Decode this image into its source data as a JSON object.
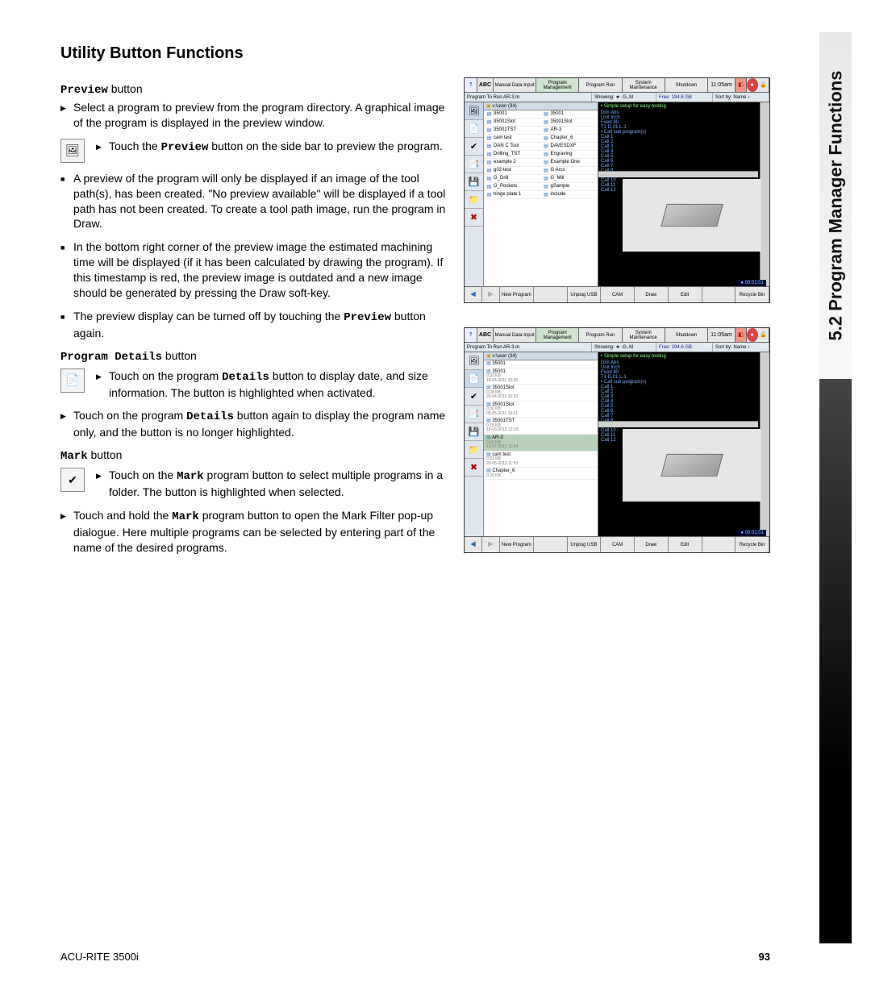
{
  "section_tab": "5.2 Program Manager Functions",
  "heading": "Utility Button Functions",
  "footer": {
    "product": "ACU-RITE 3500i",
    "page": "93"
  },
  "preview": {
    "title_mono": "Preview",
    "title_rest": " button",
    "p1": "Select a program to preview from the program directory. A graphical image of the program is displayed in the preview window.",
    "p2a": "Touch the ",
    "p2b": "Preview",
    "p2c": " button on the side bar to  preview the program.",
    "p3": "A preview of the program will only be displayed if an image of the tool path(s), has been created. \"No preview available\" will be displayed if a tool path has not been created.  To create a tool path image, run the program in Draw.",
    "p4": "In the bottom right corner of the preview image the estimated machining time will be displayed (if it has been calculated by drawing the program).  If this timestamp is red, the preview image is outdated and a new image should be generated by pressing the Draw soft-key.",
    "p5a": "The preview display can be turned off by touching the ",
    "p5b": "Preview",
    "p5c": " button again."
  },
  "details": {
    "title_mono": "Program Details",
    "title_rest": " button",
    "p1a": "Touch on the program ",
    "p1b": "Details",
    "p1c": " button to display date, and size information. The button is highlighted when activated.",
    "p2a": "Touch on the program ",
    "p2b": "Details",
    "p2c": " button again to display the program name only, and the button is no longer highlighted."
  },
  "mark": {
    "title_mono": "Mark",
    "title_rest": " button",
    "p1a": "Touch on the ",
    "p1b": "Mark",
    "p1c": " program button to select multiple programs in a folder.  The button is highlighted when selected.",
    "p2a": "Touch and hold the ",
    "p2b": "Mark",
    "p2c": " program button to open the Mark Filter pop-up dialogue. Here multiple programs can be selected by entering part of the name of the desired programs."
  },
  "ss_common": {
    "tabs": [
      "Manual Data Input",
      "Program Management",
      "Program Run",
      "System Maintenance",
      "Shutdown"
    ],
    "time": "11:05am",
    "prog_label": "Program To Run AR-3.m",
    "showing": "Showing: ★ .G,.M",
    "free": "Free: 194.6 GB",
    "sort": "Sort by: Name ↕",
    "folder": "v:\\user (34)",
    "preview_lines": [
      "• Simple setup for easy testing",
      "Dim Abs",
      "Unit Inch",
      "Feed 80",
      "   T1 D.01 L-1",
      "• Call sub program(s)",
      "Call 1",
      "Call 2",
      "Call 3",
      "Call 4",
      "Call 5",
      "Call 6",
      "Call 7",
      "Call 8",
      "Call 9",
      "Call 10",
      "Call 11",
      "Call 12"
    ],
    "timer": "● 00:01:01",
    "bottom": [
      "New Program",
      "",
      "Unplug USB",
      "CAM",
      "Draw",
      "Edit",
      "",
      "Recycle Bin"
    ]
  },
  "ss1_files_left": [
    "35001",
    "35001Slot",
    "35001TST",
    "cam test",
    "DAN C Tool",
    "Drilling_TST",
    "example 2",
    "g02-test",
    "G_Drill",
    "G_Pockets",
    "hinge plate 1"
  ],
  "ss1_files_right": [
    "35001",
    "35001Slot",
    "AR-3",
    "Chapter_6",
    "DAVESDXF",
    "Engraving",
    "Example One",
    "G Arcs",
    "G_Mill",
    "gSample",
    "include"
  ],
  "ss2_files": [
    {
      "name": "35001",
      "meta": ""
    },
    {
      "name": "35001",
      "meta": "0.32 KB\n18-04-2011 10:25"
    },
    {
      "name": "35001Slot",
      "meta": "0.28 KB\n25-04-2011 15:33"
    },
    {
      "name": "35001Slot",
      "meta": "0.30 KB\n05-05-2011 15:21"
    },
    {
      "name": "35001TST",
      "meta": "0.18 KB\n18-03-2013 12:29"
    },
    {
      "name": "AR-3",
      "meta": "0.60 KB\n16-07-2013 10:54",
      "sel": true
    },
    {
      "name": "cam test",
      "meta": "0.31 KB\n20-05-2013 11:53"
    },
    {
      "name": "Chapter_6",
      "meta": "0.20 KB"
    }
  ]
}
